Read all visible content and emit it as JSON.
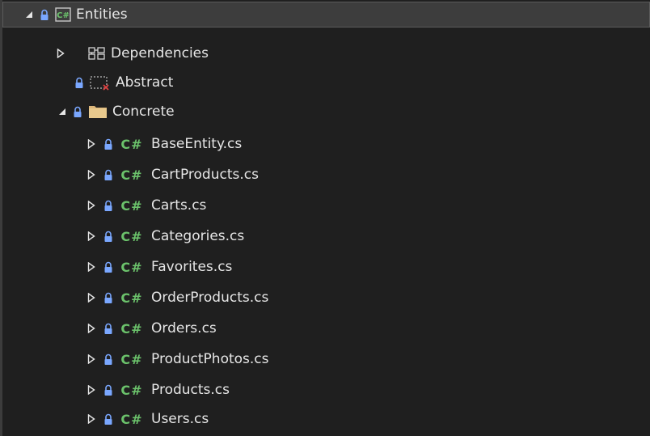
{
  "tree": {
    "project": {
      "label": "Entities",
      "icon": "csharp-project-icon"
    },
    "dependencies": {
      "label": "Dependencies",
      "icon": "dependencies-icon"
    },
    "abstract_folder": {
      "label": "Abstract",
      "icon": "excluded-folder-icon"
    },
    "concrete_folder": {
      "label": "Concrete",
      "icon": "folder-icon"
    },
    "files": [
      {
        "label": "BaseEntity.cs"
      },
      {
        "label": "CartProducts.cs"
      },
      {
        "label": "Carts.cs"
      },
      {
        "label": "Categories.cs"
      },
      {
        "label": "Favorites.cs"
      },
      {
        "label": "OrderProducts.cs"
      },
      {
        "label": "Orders.cs"
      },
      {
        "label": "ProductPhotos.cs"
      },
      {
        "label": "Products.cs"
      },
      {
        "label": "Users.cs"
      }
    ],
    "file_icon_text": "C#",
    "colors": {
      "lock": "#7aa7ff",
      "csharp": "#6bc26b",
      "folder": "#dcb67a",
      "selected_bg": "#3d3d3d"
    }
  }
}
